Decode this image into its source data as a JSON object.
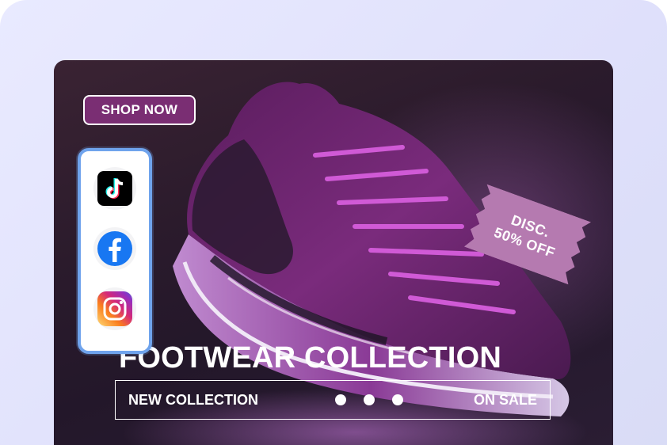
{
  "banner": {
    "shop_now_label": "SHOP NOW",
    "discount_line1": "DISC.",
    "discount_line2": "50% OFF",
    "headline": "FOOTWEAR COLLECTION",
    "info_left": "NEW COLLECTION",
    "info_right": "ON SALE",
    "pagination_count": 3
  },
  "social": {
    "items": [
      {
        "name": "TikTok",
        "icon": "tiktok-icon"
      },
      {
        "name": "Facebook",
        "icon": "facebook-icon"
      },
      {
        "name": "Instagram",
        "icon": "instagram-icon"
      }
    ]
  },
  "colors": {
    "accent_purple": "#7a2e73",
    "tag_pink": "#b57ab0",
    "facebook_blue": "#1877f2",
    "card_border": "#6fa3ec",
    "panel_bg": "#e3e4fb"
  }
}
